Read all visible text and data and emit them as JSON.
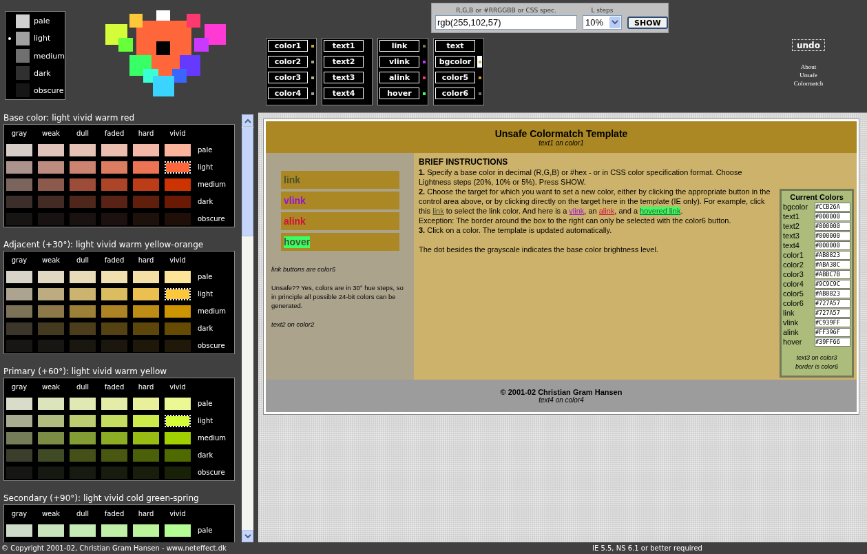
{
  "lightness_scale": [
    {
      "label": "pale",
      "color": "#d0d0d0",
      "selected": false
    },
    {
      "label": "light",
      "color": "#a0a0a0",
      "selected": true
    },
    {
      "label": "medium",
      "color": "#707070",
      "selected": false
    },
    {
      "label": "dark",
      "color": "#303030",
      "selected": false
    },
    {
      "label": "obscure",
      "color": "#161616",
      "selected": false
    }
  ],
  "color_input": {
    "label": "R,G,B or #RRGGBB or CSS spec.",
    "value": "rgb(255,102,57)",
    "steps_label": "L steps",
    "steps_value": "10%",
    "button": "SHOW"
  },
  "target_groups": [
    {
      "buttons": [
        {
          "label": "color1",
          "color": "#c8a040",
          "selected": false
        },
        {
          "label": "color2",
          "color": "#aba38c",
          "selected": false
        },
        {
          "label": "color3",
          "color": "#abbc7b",
          "selected": false
        },
        {
          "label": "color4",
          "color": "#9c9c9c",
          "selected": false
        }
      ]
    },
    {
      "buttons": [
        {
          "label": "text1",
          "selected": false
        },
        {
          "label": "text2",
          "selected": false
        },
        {
          "label": "text3",
          "selected": false
        },
        {
          "label": "text4",
          "selected": false
        }
      ]
    },
    {
      "buttons": [
        {
          "label": "link",
          "color": "#727a57",
          "selected": false
        },
        {
          "label": "vlink",
          "color": "#c939ff",
          "selected": false
        },
        {
          "label": "alink",
          "color": "#ff396f",
          "selected": false
        },
        {
          "label": "hover",
          "color": "#39ff66",
          "selected": false
        }
      ]
    },
    {
      "buttons": [
        {
          "label": "text",
          "selected": false
        },
        {
          "label": "bgcolor",
          "color": "#ccb26a",
          "selected": true
        },
        {
          "label": "color5",
          "color": "#c8a030",
          "selected": false
        },
        {
          "label": "color6",
          "color": "#727a57",
          "selected": false
        }
      ]
    }
  ],
  "undo_button": "undo",
  "about_link": "About Unsafe Colormatch",
  "palettes": [
    {
      "title": "Base color: light vivid warm red",
      "columns": [
        "gray",
        "weak",
        "dull",
        "faded",
        "hard",
        "vivid"
      ],
      "rows": [
        {
          "label": "pale",
          "swatches": [
            {
              "color": "#d6ccc8",
              "selected": false
            },
            {
              "color": "#e0c4bc",
              "selected": false
            },
            {
              "color": "#e6c2b6",
              "selected": false
            },
            {
              "color": "#ecbeb0",
              "selected": false
            },
            {
              "color": "#f4b8a8",
              "selected": false
            },
            {
              "color": "#fcb49c",
              "selected": false
            }
          ]
        },
        {
          "label": "light",
          "swatches": [
            {
              "color": "#ac948c",
              "selected": false
            },
            {
              "color": "#bc8c80",
              "selected": false
            },
            {
              "color": "#cc8470",
              "selected": false
            },
            {
              "color": "#dc7c60",
              "selected": false
            },
            {
              "color": "#ec7454",
              "selected": false
            },
            {
              "color": "#ff6639",
              "selected": true
            }
          ]
        },
        {
          "label": "medium",
          "swatches": [
            {
              "color": "#7a645c",
              "selected": false
            },
            {
              "color": "#8c5a4c",
              "selected": false
            },
            {
              "color": "#9c4c38",
              "selected": false
            },
            {
              "color": "#ac4428",
              "selected": false
            },
            {
              "color": "#bc3c18",
              "selected": false
            },
            {
              "color": "#cc3300",
              "selected": false
            }
          ]
        },
        {
          "label": "dark",
          "swatches": [
            {
              "color": "#3c2e2a",
              "selected": false
            },
            {
              "color": "#442a24",
              "selected": false
            },
            {
              "color": "#4e261c",
              "selected": false
            },
            {
              "color": "#582216",
              "selected": false
            },
            {
              "color": "#601e0c",
              "selected": false
            },
            {
              "color": "#6a1a04",
              "selected": false
            }
          ]
        },
        {
          "label": "obscure",
          "swatches": [
            {
              "color": "#171514",
              "selected": false
            },
            {
              "color": "#181312",
              "selected": false
            },
            {
              "color": "#1a1210",
              "selected": false
            },
            {
              "color": "#1c110e",
              "selected": false
            },
            {
              "color": "#1e100b",
              "selected": false
            },
            {
              "color": "#200f08",
              "selected": false
            }
          ]
        }
      ]
    },
    {
      "title": "Adjacent (+30°): light vivid warm yellow-orange",
      "columns": [
        "gray",
        "weak",
        "dull",
        "faded",
        "hard",
        "vivid"
      ],
      "rows": [
        {
          "label": "pale",
          "swatches": [
            {
              "color": "#d8d4c8",
              "selected": false
            },
            {
              "color": "#e0d8c0",
              "selected": false
            },
            {
              "color": "#e8dcb8",
              "selected": false
            },
            {
              "color": "#f0e0b0",
              "selected": false
            },
            {
              "color": "#f4e0a4",
              "selected": false
            },
            {
              "color": "#fce498",
              "selected": false
            }
          ]
        },
        {
          "label": "light",
          "swatches": [
            {
              "color": "#aca490",
              "selected": false
            },
            {
              "color": "#bcac80",
              "selected": false
            },
            {
              "color": "#ccb470",
              "selected": false
            },
            {
              "color": "#dcbc60",
              "selected": false
            },
            {
              "color": "#ecc050",
              "selected": false
            },
            {
              "color": "#fcc839",
              "selected": true
            }
          ]
        },
        {
          "label": "medium",
          "swatches": [
            {
              "color": "#7c7258",
              "selected": false
            },
            {
              "color": "#8c7848",
              "selected": false
            },
            {
              "color": "#9c8038",
              "selected": false
            },
            {
              "color": "#ac8424",
              "selected": false
            },
            {
              "color": "#bc8c14",
              "selected": false
            },
            {
              "color": "#cc9400",
              "selected": false
            }
          ]
        },
        {
          "label": "dark",
          "swatches": [
            {
              "color": "#3c362a",
              "selected": false
            },
            {
              "color": "#443a20",
              "selected": false
            },
            {
              "color": "#4c3e1a",
              "selected": false
            },
            {
              "color": "#544212",
              "selected": false
            },
            {
              "color": "#5c460a",
              "selected": false
            },
            {
              "color": "#644a02",
              "selected": false
            }
          ]
        },
        {
          "label": "obscure",
          "swatches": [
            {
              "color": "#171614",
              "selected": false
            },
            {
              "color": "#181612",
              "selected": false
            },
            {
              "color": "#1a1710",
              "selected": false
            },
            {
              "color": "#1c170e",
              "selected": false
            },
            {
              "color": "#1e180b",
              "selected": false
            },
            {
              "color": "#201808",
              "selected": false
            }
          ]
        }
      ]
    },
    {
      "title": "Primary (+60°): light vivid warm yellow",
      "columns": [
        "gray",
        "weak",
        "dull",
        "faded",
        "hard",
        "vivid"
      ],
      "rows": [
        {
          "label": "pale",
          "swatches": [
            {
              "color": "#d8dcc8",
              "selected": false
            },
            {
              "color": "#dce4bc",
              "selected": false
            },
            {
              "color": "#e0e8b4",
              "selected": false
            },
            {
              "color": "#e4eca8",
              "selected": false
            },
            {
              "color": "#e8f09c",
              "selected": false
            },
            {
              "color": "#ecf894",
              "selected": false
            }
          ]
        },
        {
          "label": "light",
          "swatches": [
            {
              "color": "#a8ac90",
              "selected": false
            },
            {
              "color": "#b0bc80",
              "selected": false
            },
            {
              "color": "#bccc70",
              "selected": false
            },
            {
              "color": "#c4dc60",
              "selected": false
            },
            {
              "color": "#ccec4c",
              "selected": false
            },
            {
              "color": "#d4fc39",
              "selected": true
            }
          ]
        },
        {
          "label": "medium",
          "swatches": [
            {
              "color": "#747c58",
              "selected": false
            },
            {
              "color": "#7c8c44",
              "selected": false
            },
            {
              "color": "#849c34",
              "selected": false
            },
            {
              "color": "#8cac24",
              "selected": false
            },
            {
              "color": "#98bc14",
              "selected": false
            },
            {
              "color": "#a0d000",
              "selected": false
            }
          ]
        },
        {
          "label": "dark",
          "swatches": [
            {
              "color": "#3c3e2c",
              "selected": false
            },
            {
              "color": "#404a24",
              "selected": false
            },
            {
              "color": "#445018",
              "selected": false
            },
            {
              "color": "#485810",
              "selected": false
            },
            {
              "color": "#4c600a",
              "selected": false
            },
            {
              "color": "#506a02",
              "selected": false
            }
          ]
        },
        {
          "label": "obscure",
          "swatches": [
            {
              "color": "#161714",
              "selected": false
            },
            {
              "color": "#161812",
              "selected": false
            },
            {
              "color": "#171a10",
              "selected": false
            },
            {
              "color": "#171c0e",
              "selected": false
            },
            {
              "color": "#181e0b",
              "selected": false
            },
            {
              "color": "#182008",
              "selected": false
            }
          ]
        }
      ]
    },
    {
      "title": "Secondary (+90°): light vivid cold green-spring",
      "columns": [
        "gray",
        "weak",
        "dull",
        "faded",
        "hard",
        "vivid"
      ],
      "rows": [
        {
          "label": "pale",
          "swatches": [
            {
              "color": "#ccdcc8",
              "selected": false
            },
            {
              "color": "#c8e4bc",
              "selected": false
            },
            {
              "color": "#c4ecb4",
              "selected": false
            },
            {
              "color": "#c0f0a8",
              "selected": false
            },
            {
              "color": "#bcf49c",
              "selected": false
            },
            {
              "color": "#b4fc94",
              "selected": false
            }
          ]
        }
      ]
    }
  ],
  "template": {
    "title": "Unsafe Colormatch Template",
    "subtitle": "text1 on color1",
    "link_buttons": [
      {
        "kind": "link",
        "label": "link"
      },
      {
        "kind": "vlink",
        "label": "vlink"
      },
      {
        "kind": "alink",
        "label": "alink"
      },
      {
        "kind": "hover",
        "label": "hover"
      }
    ],
    "side_notes": [
      {
        "kind": "note",
        "text": "link buttons are color5"
      },
      {
        "kind": "body",
        "text": "Unsafe?? Yes, colors are in 30° hue steps, so in principle all possible 24-bit colors can be generated."
      },
      {
        "kind": "note",
        "text": "text2 on color2"
      }
    ],
    "instructions_title": "BRIEF INSTRUCTIONS",
    "paragraphs": [
      {
        "parts": [
          {
            "kind": "text",
            "text": "**1.** Specify a base color in decimal (R,G,B) or #hex - or in CSS color specification format. Choose Lightness steps (20%, 10% or 5%). Press SHOW."
          }
        ]
      },
      {
        "parts": [
          {
            "kind": "text",
            "text": "**2.** Choose the target for which you want to set a new color, either by clicking the appropriate button in the control area above, or by clicking directly on the target here in the template (IE only). For example, click this "
          },
          {
            "kind": "link",
            "text": "link"
          },
          {
            "kind": "text",
            "text": " to select the link color. And here is a "
          },
          {
            "kind": "vlink",
            "text": "vlink"
          },
          {
            "kind": "text",
            "text": ", an "
          },
          {
            "kind": "alink",
            "text": "alink"
          },
          {
            "kind": "text",
            "text": ", and a "
          },
          {
            "kind": "hover",
            "text": "hovered link"
          },
          {
            "kind": "text",
            "text": "."
          }
        ]
      },
      {
        "parts": [
          {
            "kind": "text",
            "text": "Exception: The border around the box to the right can only be selected with the color6 button."
          }
        ]
      },
      {
        "parts": [
          {
            "kind": "text",
            "text": "**3.** Click on a color. The template is updated automatically."
          }
        ]
      },
      {
        "parts": [
          {
            "kind": "text",
            "text": "The dot besides the grayscale indicates the base color brightness level."
          }
        ]
      }
    ],
    "current_colors": {
      "title": "Current Colors",
      "rows": [
        {
          "label": "bgcolor",
          "value": "#CCB26A"
        },
        {
          "label": "text1",
          "value": "#000000"
        },
        {
          "label": "text2",
          "value": "#000000"
        },
        {
          "label": "text3",
          "value": "#000000"
        },
        {
          "label": "text4",
          "value": "#000000"
        },
        {
          "label": "color1",
          "value": "#AB8823"
        },
        {
          "label": "color2",
          "value": "#ABA38C"
        },
        {
          "label": "color3",
          "value": "#ABBC7B"
        },
        {
          "label": "color4",
          "value": "#9C9C9C"
        },
        {
          "label": "color5",
          "value": "#AB8823"
        },
        {
          "label": "color6",
          "value": "#727A57"
        },
        {
          "label": "link",
          "value": "#727A57"
        },
        {
          "label": "vlink",
          "value": "#C939FF"
        },
        {
          "label": "alink",
          "value": "#FF396F"
        },
        {
          "label": "hover",
          "value": "#39FF66"
        }
      ],
      "notes": [
        "text3 on color3",
        "border is color6"
      ]
    },
    "footer": {
      "title": "© 2001-02 Christian Gram Hansen",
      "subtitle": "text4 on color4"
    }
  },
  "status_bar": {
    "copyright": "© Copyright 2001-02, Christian Gram Hansen - www.neteffect.dk",
    "requirement": "IE 5.5, NS 6.1 or better required"
  }
}
